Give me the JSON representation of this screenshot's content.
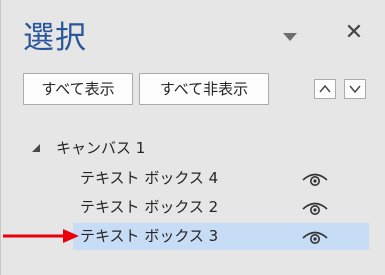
{
  "pane": {
    "title": "選択",
    "menu_icon": "dropdown-triangle-icon",
    "close_label": "✕"
  },
  "toolbar": {
    "show_all_label": "すべて表示",
    "hide_all_label": "すべて非表示",
    "move_up_icon": "chevron-up-icon",
    "move_down_icon": "chevron-down-icon"
  },
  "tree": {
    "group": {
      "label": "キャンバス 1",
      "expanded": true
    },
    "items": [
      {
        "label": "テキスト ボックス 4",
        "visible": true,
        "selected": false
      },
      {
        "label": "テキスト ボックス 2",
        "visible": true,
        "selected": false
      },
      {
        "label": "テキスト ボックス 3",
        "visible": true,
        "selected": true
      }
    ]
  },
  "colors": {
    "title": "#2b579a",
    "selection": "#c7dcf5",
    "annotation_arrow": "#e8000b",
    "pane_background": "#e6e6e6"
  }
}
